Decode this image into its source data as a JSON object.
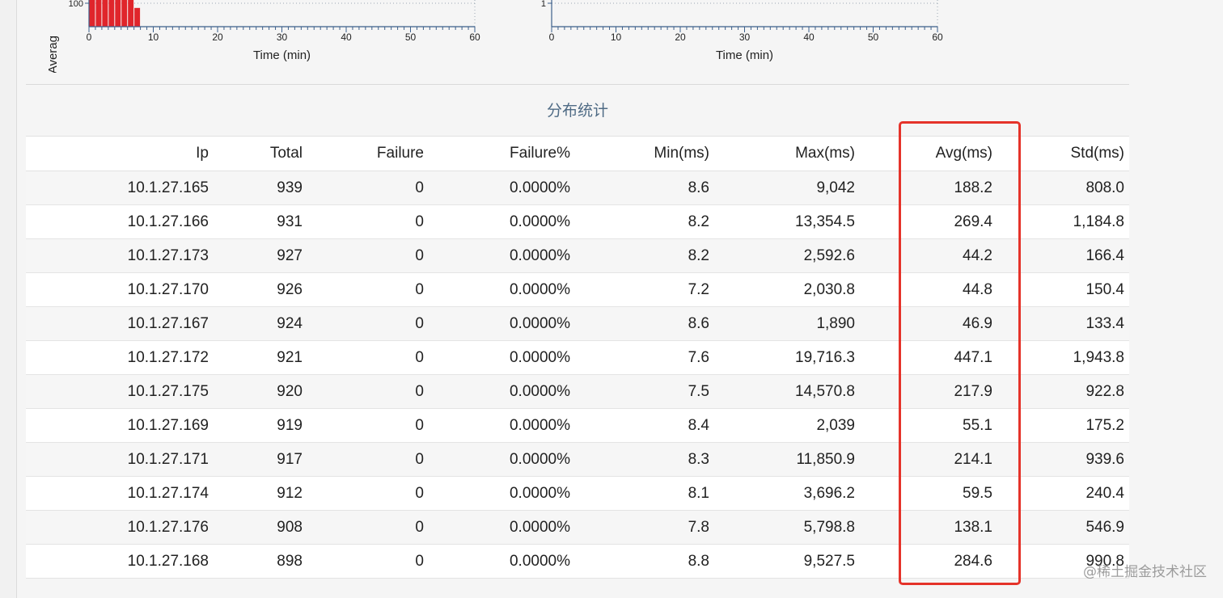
{
  "chart_data": [
    {
      "type": "bar",
      "xlabel": "Time (min)",
      "ylabel": "Averag",
      "xlim": [
        0,
        60
      ],
      "x_ticks": [
        0,
        10,
        20,
        30,
        40,
        50,
        60
      ],
      "y_tick_label": "100",
      "y_tick_value": 100,
      "bar_color": "#e0252b",
      "x": [
        0,
        1,
        2,
        3,
        4,
        5,
        6,
        7
      ],
      "values": [
        140,
        140,
        140,
        140,
        130,
        140,
        120,
        80
      ]
    },
    {
      "type": "line",
      "xlabel": "Time (min)",
      "xlim": [
        0,
        60
      ],
      "x_ticks": [
        0,
        10,
        20,
        30,
        40,
        50,
        60
      ],
      "y_tick_label": "1",
      "y_tick_value": 1
    }
  ],
  "section": {
    "title": "分布统计"
  },
  "table": {
    "columns": [
      "Ip",
      "Total",
      "Failure",
      "Failure%",
      "Min(ms)",
      "Max(ms)",
      "Avg(ms)",
      "Std(ms)"
    ],
    "rows": [
      [
        "10.1.27.165",
        "939",
        "0",
        "0.0000%",
        "8.6",
        "9,042",
        "188.2",
        "808.0"
      ],
      [
        "10.1.27.166",
        "931",
        "0",
        "0.0000%",
        "8.2",
        "13,354.5",
        "269.4",
        "1,184.8"
      ],
      [
        "10.1.27.173",
        "927",
        "0",
        "0.0000%",
        "8.2",
        "2,592.6",
        "44.2",
        "166.4"
      ],
      [
        "10.1.27.170",
        "926",
        "0",
        "0.0000%",
        "7.2",
        "2,030.8",
        "44.8",
        "150.4"
      ],
      [
        "10.1.27.167",
        "924",
        "0",
        "0.0000%",
        "8.6",
        "1,890",
        "46.9",
        "133.4"
      ],
      [
        "10.1.27.172",
        "921",
        "0",
        "0.0000%",
        "7.6",
        "19,716.3",
        "447.1",
        "1,943.8"
      ],
      [
        "10.1.27.175",
        "920",
        "0",
        "0.0000%",
        "7.5",
        "14,570.8",
        "217.9",
        "922.8"
      ],
      [
        "10.1.27.169",
        "919",
        "0",
        "0.0000%",
        "8.4",
        "2,039",
        "55.1",
        "175.2"
      ],
      [
        "10.1.27.171",
        "917",
        "0",
        "0.0000%",
        "8.3",
        "11,850.9",
        "214.1",
        "939.6"
      ],
      [
        "10.1.27.174",
        "912",
        "0",
        "0.0000%",
        "8.1",
        "3,696.2",
        "59.5",
        "240.4"
      ],
      [
        "10.1.27.176",
        "908",
        "0",
        "0.0000%",
        "7.8",
        "5,798.8",
        "138.1",
        "546.9"
      ],
      [
        "10.1.27.168",
        "898",
        "0",
        "0.0000%",
        "8.8",
        "9,527.5",
        "284.6",
        "990.8"
      ]
    ]
  },
  "highlight": {
    "color": "#e5332a"
  },
  "watermark": {
    "text": "@稀土掘金技术社区"
  }
}
